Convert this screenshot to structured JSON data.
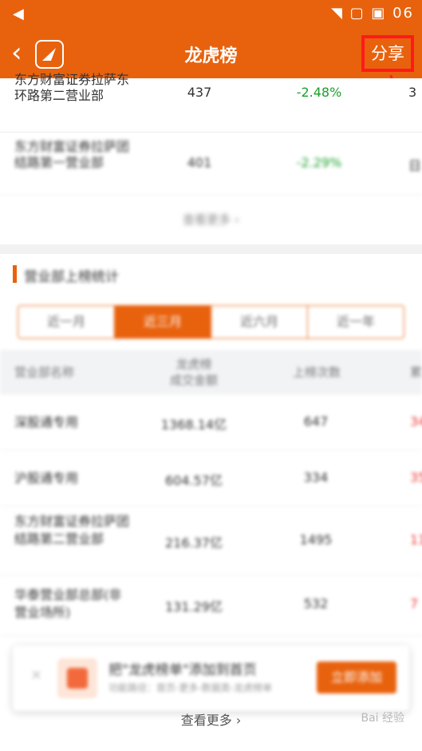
{
  "statusbar": {
    "left_glyph": "◀",
    "right_text": "◥ ▢ ▣ 06"
  },
  "header": {
    "back_label": "‹",
    "title": "龙虎榜",
    "share_label": "分享"
  },
  "top_list": {
    "rows": [
      {
        "name": "东方财富证券拉萨东环路第二营业部",
        "amount": "437",
        "pct": "-2.48%",
        "cut": "3"
      },
      {
        "name": "东方财富证券拉萨团结路第一营业部",
        "amount": "401",
        "pct": "-2.29%",
        "cut": "日"
      }
    ],
    "more_label": "查看更多 ›"
  },
  "section": {
    "title": "营业部上榜统计",
    "tabs": [
      {
        "label": "近一月",
        "active": false
      },
      {
        "label": "近三月",
        "active": true
      },
      {
        "label": "近六月",
        "active": false
      },
      {
        "label": "近一年",
        "active": false
      }
    ],
    "columns": [
      "营业部名称",
      "龙虎榜\n成交金额",
      "上榜次数",
      "累"
    ],
    "rows": [
      {
        "name": "深股通专用",
        "amount": "1368.14亿",
        "count": "647",
        "extra": "34"
      },
      {
        "name": "沪股通专用",
        "amount": "604.57亿",
        "count": "334",
        "extra": "35"
      },
      {
        "name": "东方财富证券拉萨团结路第二营业部",
        "amount": "216.37亿",
        "count": "1495",
        "extra": "11"
      },
      {
        "name": "华泰营业部总部(非营业场所)",
        "amount": "131.29亿",
        "count": "532",
        "extra": "7"
      }
    ],
    "more_label": "查看更多 ›"
  },
  "banner": {
    "close_label": "×",
    "title": "把\"龙虎榜单\"添加到首页",
    "subtitle": "功能路径：首页-更多-数据类-龙虎榜单",
    "button_label": "立即添加"
  },
  "watermark": "Bai 经验"
}
